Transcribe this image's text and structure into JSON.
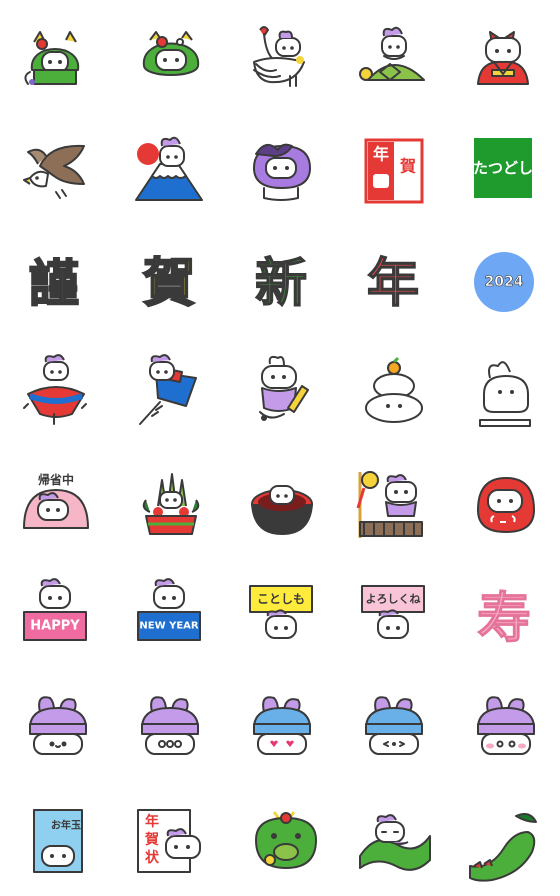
{
  "sheet": {
    "row3": {
      "kin": "謹",
      "ga": "賀",
      "shin": "新",
      "nen": "年",
      "year": "2024"
    },
    "row2": {
      "nenga_nen": "年",
      "nenga_ga": "賀",
      "tatsudoshi": "たつどし"
    },
    "row5": {
      "kisei": "帰省中"
    },
    "row6": {
      "happy": "HAPPY",
      "newyear": "NEW YEAR",
      "kotoshimo": "ことしも",
      "yoroshiku": "よろしくね",
      "kotobuki": "寿"
    },
    "row8": {
      "otoshidama": "お年玉",
      "nengajo_1": "年",
      "nengajo_2": "賀",
      "nengajo_3": "状"
    }
  },
  "colors": {
    "dragon_green": "#4caf3c",
    "lavender": "#c39be8",
    "red": "#e53935",
    "pink": "#f48fb1",
    "blue": "#1e6fcf",
    "yellow": "#ffeb3b",
    "sky": "#6ea8f5",
    "line": "#3a3a3a"
  }
}
